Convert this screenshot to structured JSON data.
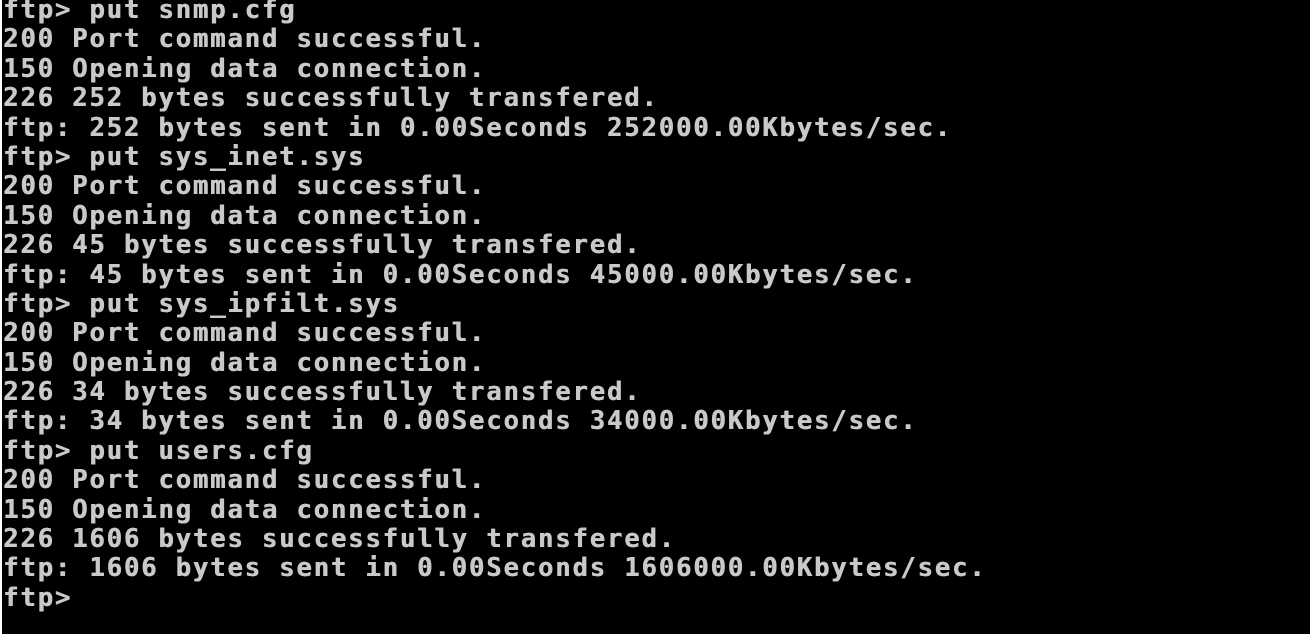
{
  "console": {
    "lines": [
      "ftp> put snmp.cfg",
      "200 Port command successful.",
      "150 Opening data connection.",
      "226 252 bytes successfully transfered.",
      "ftp: 252 bytes sent in 0.00Seconds 252000.00Kbytes/sec.",
      "ftp> put sys_inet.sys",
      "200 Port command successful.",
      "150 Opening data connection.",
      "226 45 bytes successfully transfered.",
      "ftp: 45 bytes sent in 0.00Seconds 45000.00Kbytes/sec.",
      "ftp> put sys_ipfilt.sys",
      "200 Port command successful.",
      "150 Opening data connection.",
      "226 34 bytes successfully transfered.",
      "ftp: 34 bytes sent in 0.00Seconds 34000.00Kbytes/sec.",
      "ftp> put users.cfg",
      "200 Port command successful.",
      "150 Opening data connection.",
      "226 1606 bytes successfully transfered.",
      "ftp: 1606 bytes sent in 0.00Seconds 1606000.00Kbytes/sec."
    ],
    "prompt": "ftp>"
  },
  "colors": {
    "background": "#000000",
    "text": "#c9c9c9"
  }
}
